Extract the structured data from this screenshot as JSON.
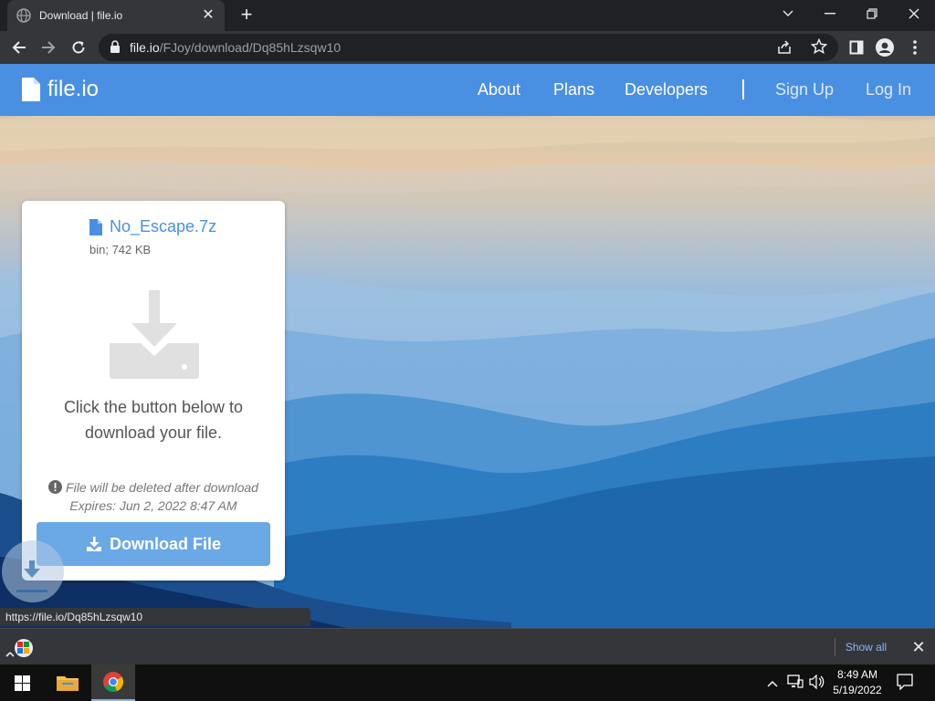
{
  "browser": {
    "tab_title": "Download | file.io",
    "url_host": "file.io",
    "url_path": "/FJoy/download/Dq85hLzsqw10",
    "status_url": "https://file.io/Dq85hLzsqw10"
  },
  "site": {
    "brand": "file.io",
    "nav": [
      "About",
      "Plans",
      "Developers"
    ],
    "auth": [
      "Sign Up",
      "Log In"
    ]
  },
  "file": {
    "name": "No_Escape.7z",
    "meta": "bin; 742 KB",
    "instructions": "Click the button below to download your file.",
    "note_line1": "File will be deleted after download",
    "note_line2": "Expires: Jun 2, 2022 8:47 AM",
    "download_label": "Download File"
  },
  "shelf": {
    "show_all": "Show all"
  },
  "taskbar": {
    "time": "8:49 AM",
    "date": "5/19/2022"
  },
  "colors": {
    "brand_blue": "#4a90e2",
    "button_blue": "#6aa8e6",
    "chrome_dark": "#202124",
    "chrome_mid": "#35363a"
  },
  "icons": [
    "globe-icon",
    "close-icon",
    "plus-icon",
    "chevron-down-icon",
    "minimize-icon",
    "restore-icon",
    "back-icon",
    "forward-icon",
    "reload-icon",
    "lock-icon",
    "share-icon",
    "star-icon",
    "sidepanel-icon",
    "profile-icon",
    "menu-icon",
    "file-icon",
    "download-tray-icon",
    "info-icon",
    "download-icon",
    "archive-icon",
    "windows-start-icon",
    "file-explorer-icon",
    "chrome-icon",
    "chevron-up-icon",
    "network-icon",
    "volume-icon",
    "notification-icon"
  ]
}
